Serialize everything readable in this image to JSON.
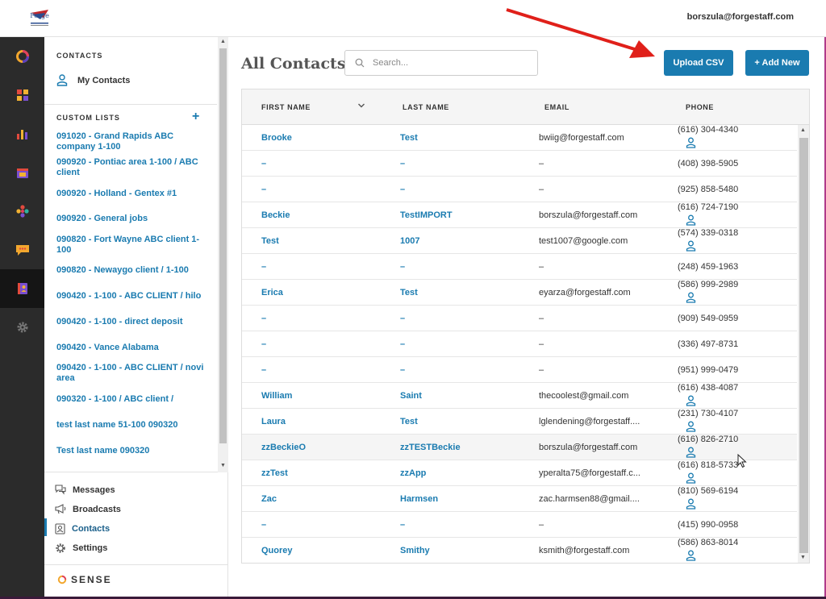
{
  "header": {
    "logo_text": "Forge",
    "user_email": "borszula@forgestaff.com"
  },
  "rail": {
    "items": [
      {
        "icon": "sense-ring-icon"
      },
      {
        "icon": "grid-apps-icon"
      },
      {
        "icon": "bar-chart-icon"
      },
      {
        "icon": "calendar-icon"
      },
      {
        "icon": "dots-cluster-icon"
      },
      {
        "icon": "chat-bubble-icon"
      },
      {
        "icon": "contacts-book-icon"
      },
      {
        "icon": "gear-icon"
      }
    ]
  },
  "sidebar": {
    "contacts_heading": "CONTACTS",
    "my_contacts": "My Contacts",
    "custom_lists_heading": "CUSTOM LISTS",
    "lists": [
      "091020 - Grand Rapids ABC company 1-100",
      "090920 - Pontiac area 1-100 / ABC client",
      "090920 - Holland - Gentex #1",
      "090920 - General jobs",
      "090820 - Fort Wayne ABC client 1-100",
      "090820 - Newaygo client / 1-100",
      "090420 - 1-100 - ABC CLIENT / hilo",
      "090420 - 1-100 - direct deposit",
      "090420 - Vance Alabama",
      "090420 - 1-100 - ABC CLIENT / novi area",
      "090320 - 1-100 / ABC client /",
      "test last name 51-100 090320",
      "Test last name 090320"
    ],
    "nav": {
      "messages": "Messages",
      "broadcasts": "Broadcasts",
      "contacts": "Contacts",
      "settings": "Settings"
    },
    "brand": "SENSE"
  },
  "main": {
    "title": "All Contacts",
    "search_placeholder": "Search...",
    "upload_label": "Upload CSV",
    "add_new_label": "+ Add New",
    "columns": {
      "first": "FIRST NAME",
      "last": "LAST NAME",
      "email": "EMAIL",
      "phone": "PHONE"
    },
    "rows": [
      {
        "first": "Brooke",
        "last": "Test",
        "email": "bwiig@forgestaff.com",
        "phone": "(616) 304-4340",
        "icon": true
      },
      {
        "first": "–",
        "last": "–",
        "email": "–",
        "phone": "(408) 398-5905",
        "icon": false
      },
      {
        "first": "–",
        "last": "–",
        "email": "–",
        "phone": "(925) 858-5480",
        "icon": false
      },
      {
        "first": "Beckie",
        "last": "TestIMPORT",
        "email": "borszula@forgestaff.com",
        "phone": "(616) 724-7190",
        "icon": true
      },
      {
        "first": "Test",
        "last": "1007",
        "email": "test1007@google.com",
        "phone": "(574) 339-0318",
        "icon": true
      },
      {
        "first": "–",
        "last": "–",
        "email": "–",
        "phone": "(248) 459-1963",
        "icon": false
      },
      {
        "first": "Erica",
        "last": "Test",
        "email": "eyarza@forgestaff.com",
        "phone": "(586) 999-2989",
        "icon": true
      },
      {
        "first": "–",
        "last": "–",
        "email": "–",
        "phone": "(909) 549-0959",
        "icon": false
      },
      {
        "first": "–",
        "last": "–",
        "email": "–",
        "phone": "(336) 497-8731",
        "icon": false
      },
      {
        "first": "–",
        "last": "–",
        "email": "–",
        "phone": "(951) 999-0479",
        "icon": false
      },
      {
        "first": "William",
        "last": "Saint",
        "email": "thecoolest@gmail.com",
        "phone": "(616) 438-4087",
        "icon": true
      },
      {
        "first": "Laura",
        "last": "Test",
        "email": "lglendening@forgestaff....",
        "phone": "(231) 730-4107",
        "icon": true
      },
      {
        "first": "zzBeckieO",
        "last": "zzTESTBeckie",
        "email": "borszula@forgestaff.com",
        "phone": "(616) 826-2710",
        "icon": true
      },
      {
        "first": "zzTest",
        "last": "zzApp",
        "email": "yperalta75@forgestaff.c...",
        "phone": "(616) 818-5733",
        "icon": true
      },
      {
        "first": "Zac",
        "last": "Harmsen",
        "email": "zac.harmsen88@gmail....",
        "phone": "(810) 569-6194",
        "icon": true
      },
      {
        "first": "–",
        "last": "–",
        "email": "–",
        "phone": "(415) 990-0958",
        "icon": false
      },
      {
        "first": "Quorey",
        "last": "Smithy",
        "email": "ksmith@forgestaff.com",
        "phone": "(586) 863-8014",
        "icon": true
      }
    ]
  },
  "colors": {
    "accent": "#1a7bb0",
    "rail_bg": "#2b2b2b",
    "annotation_arrow": "#e0201a"
  }
}
